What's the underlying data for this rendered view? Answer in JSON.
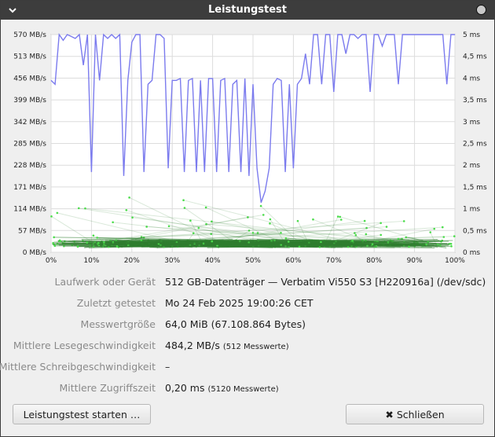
{
  "window": {
    "title": "Leistungstest"
  },
  "chart_data": {
    "type": "line",
    "y_left": {
      "labels": [
        "570 MB/s",
        "513 MB/s",
        "456 MB/s",
        "399 MB/s",
        "342 MB/s",
        "285 MB/s",
        "228 MB/s",
        "171 MB/s",
        "114 MB/s",
        "57 MB/s",
        "0 MB/s"
      ],
      "ylim": [
        0,
        570
      ]
    },
    "y_right": {
      "labels": [
        "5 ms",
        "4,5 ms",
        "4 ms",
        "3,5 ms",
        "3 ms",
        "2,5 ms",
        "2 ms",
        "1,5 ms",
        "1 ms",
        "0,5 ms",
        "0 ms"
      ],
      "ylim": [
        0,
        5
      ]
    },
    "x": {
      "labels": [
        "0%",
        "10%",
        "20%",
        "30%",
        "40%",
        "50%",
        "60%",
        "70%",
        "80%",
        "90%",
        "100%"
      ],
      "xlim": [
        0,
        100
      ]
    },
    "grid": true,
    "read_rate": {
      "color": "#7b7bee",
      "x": [
        0,
        1,
        2,
        3,
        4,
        5,
        6,
        7,
        8,
        9,
        10,
        11,
        12,
        13,
        14,
        15,
        16,
        17,
        18,
        19,
        20,
        21,
        22,
        23,
        24,
        25,
        26,
        27,
        28,
        29,
        30,
        31,
        32,
        33,
        34,
        35,
        36,
        37,
        38,
        39,
        40,
        41,
        42,
        43,
        44,
        45,
        46,
        47,
        48,
        49,
        50,
        51,
        52,
        53,
        54,
        55,
        56,
        57,
        58,
        59,
        60,
        61,
        62,
        63,
        64,
        65,
        66,
        67,
        68,
        69,
        70,
        71,
        72,
        73,
        74,
        75,
        76,
        77,
        78,
        79,
        80,
        81,
        82,
        83,
        84,
        85,
        86,
        87,
        88,
        89,
        90,
        91,
        92,
        93,
        94,
        95,
        96,
        97,
        98,
        99,
        100
      ],
      "y": [
        450,
        440,
        570,
        555,
        570,
        565,
        560,
        570,
        490,
        570,
        210,
        570,
        450,
        570,
        560,
        570,
        560,
        570,
        200,
        450,
        550,
        570,
        570,
        210,
        440,
        450,
        570,
        570,
        560,
        220,
        450,
        450,
        455,
        210,
        450,
        455,
        210,
        450,
        210,
        455,
        455,
        210,
        450,
        455,
        210,
        440,
        450,
        210,
        455,
        200,
        440,
        220,
        130,
        160,
        220,
        440,
        455,
        450,
        210,
        440,
        220,
        440,
        455,
        520,
        440,
        570,
        570,
        440,
        570,
        570,
        420,
        570,
        570,
        520,
        570,
        570,
        560,
        570,
        570,
        420,
        570,
        570,
        540,
        570,
        570,
        570,
        440,
        570,
        570,
        570,
        570,
        570,
        570,
        570,
        570,
        570,
        570,
        570,
        440,
        570,
        570
      ]
    },
    "access_time_ms": {
      "color": "#4cdd4c",
      "typical_ms": 0.2,
      "max_ms": 1.6
    }
  },
  "info": {
    "drive": {
      "label": "Laufwerk oder Gerät",
      "value": "512 GB-Datenträger — Verbatim Vi550 S3 [H220916a] (/dev/sdc)"
    },
    "last_test": {
      "label": "Zuletzt getestet",
      "value": "Mo 24 Feb 2025 19:00:26 CET"
    },
    "sample_size": {
      "label": "Messwertgröße",
      "value": "64,0 MiB (67.108.864 Bytes)"
    },
    "avg_read": {
      "label": "Mittlere Lesegeschwindigkeit",
      "value": "484,2 MB/s",
      "note": "(512 Messwerte)"
    },
    "avg_write": {
      "label": "Mittlere Schreibgeschwindigkeit",
      "value": "–"
    },
    "avg_access": {
      "label": "Mittlere Zugriffszeit",
      "value": "0,20 ms",
      "note": "(5120 Messwerte)"
    }
  },
  "buttons": {
    "start": "Leistungstest starten …",
    "close": "Schließen"
  }
}
